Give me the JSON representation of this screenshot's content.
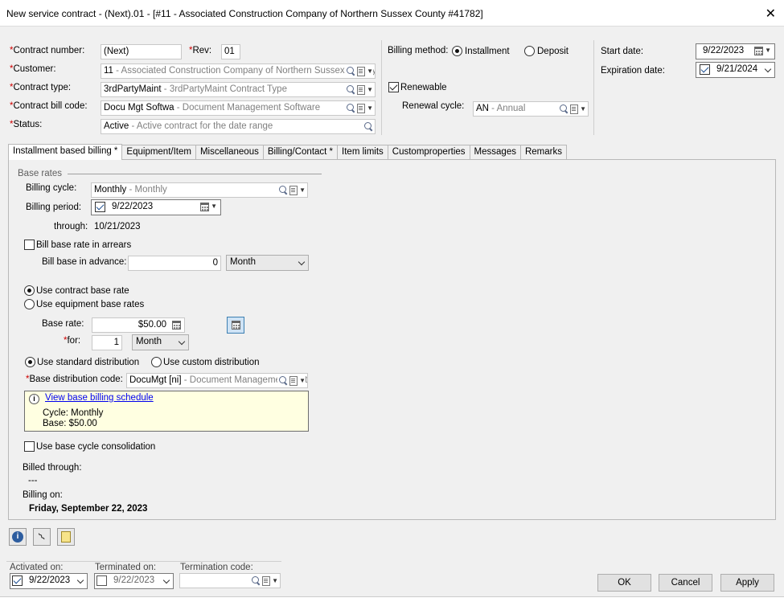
{
  "window": {
    "title": "New service contract - (Next).01 - [#11 - Associated Construction Company of Northern Sussex County #41782]"
  },
  "header": {
    "contract_number": {
      "label": "Contract number:",
      "value": "(Next)"
    },
    "rev": {
      "label": "Rev:",
      "value": "01"
    },
    "customer": {
      "label": "Customer:",
      "code": "11",
      "desc": " - Associated Construction Company of Northern Sussex County"
    },
    "contract_type": {
      "label": "Contract type:",
      "code": "3rdPartyMaint",
      "desc": " - 3rdPartyMaint Contract Type"
    },
    "contract_bill_code": {
      "label": "Contract bill code:",
      "code": "Docu Mgt Softwa",
      "desc": " - Document Management Software"
    },
    "status": {
      "label": "Status:",
      "code": "Active",
      "desc": " - Active contract for the date range"
    },
    "billing_method": {
      "label": "Billing method:",
      "options": [
        "Installment",
        "Deposit"
      ],
      "selected": "Installment"
    },
    "renewable": {
      "label": "Renewable",
      "checked": true
    },
    "renewal_cycle": {
      "label": "Renewal cycle:",
      "code": "AN",
      "desc": " - Annual"
    },
    "start_date": {
      "label": "Start date:",
      "value": "9/22/2023"
    },
    "expiration_date": {
      "label": "Expiration date:",
      "value": "9/21/2024",
      "checked": true
    }
  },
  "tabs": [
    {
      "label": "Installment based billing *",
      "active": true
    },
    {
      "label": "Equipment/Item"
    },
    {
      "label": "Miscellaneous"
    },
    {
      "label": "Billing/Contact *"
    },
    {
      "label": "Item limits"
    },
    {
      "label": "Customproperties"
    },
    {
      "label": "Messages"
    },
    {
      "label": "Remarks"
    }
  ],
  "installment": {
    "section_title": "Base rates",
    "billing_cycle": {
      "label": "Billing cycle:",
      "code": "Monthly",
      "desc": " - Monthly"
    },
    "billing_period": {
      "label": "Billing period:",
      "value": "9/22/2023",
      "checked": true
    },
    "through": {
      "label": "through:",
      "value": "10/21/2023"
    },
    "bill_in_arrears": {
      "label": "Bill base rate in arrears",
      "checked": false
    },
    "bill_in_advance": {
      "label": "Bill base in advance:",
      "value": "0",
      "unit": "Month"
    },
    "rate_source": {
      "options": [
        "Use contract base rate",
        "Use equipment base rates"
      ],
      "selected": "Use contract base rate"
    },
    "base_rate": {
      "label": "Base rate:",
      "value": "$50.00"
    },
    "for": {
      "label": "for:",
      "value": "1",
      "unit": "Month"
    },
    "distribution": {
      "options": [
        "Use standard distribution",
        "Use custom distribution"
      ],
      "selected": "Use standard distribution"
    },
    "base_distribution_code": {
      "label": "Base distribution code:",
      "code": "DocuMgt [ni]",
      "desc": " - Document Management Software"
    },
    "schedule": {
      "link": "View base billing schedule",
      "cycle": "Cycle: Monthly",
      "base": "Base: $50.00"
    },
    "base_cycle_consolidation": {
      "label": "Use base cycle consolidation",
      "checked": false
    },
    "billed_through": {
      "label": "Billed through:",
      "value": "---"
    },
    "billing_on": {
      "label": "Billing on:",
      "value": "Friday, September 22, 2023"
    }
  },
  "footer": {
    "activated_on": {
      "label": "Activated on:",
      "value": "9/22/2023",
      "checked": true
    },
    "terminated_on": {
      "label": "Terminated on:",
      "value": "9/22/2023",
      "checked": false
    },
    "termination_code": {
      "label": "Termination code:",
      "value": ""
    },
    "buttons": {
      "ok": "OK",
      "cancel": "Cancel",
      "apply": "Apply"
    }
  }
}
